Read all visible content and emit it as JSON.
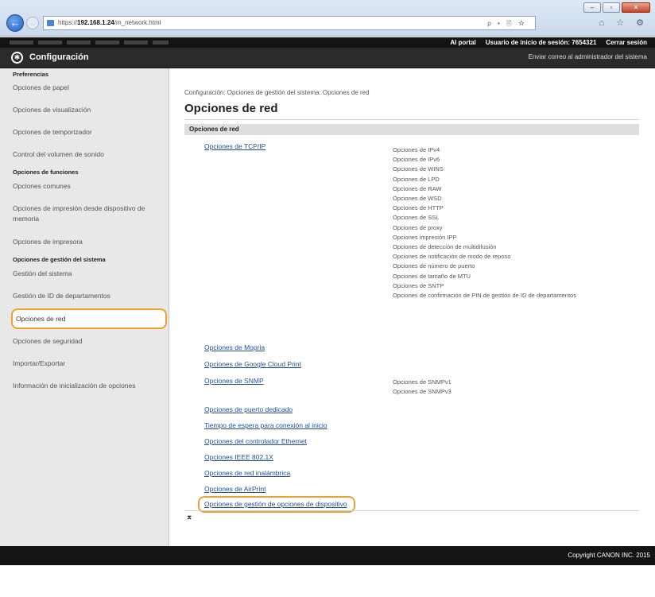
{
  "browser": {
    "url_prefix": "https://",
    "url_host": "192.168.1.24",
    "url_path": "/m_network.html",
    "tools": "ρ • 🖹 ☆",
    "tab_icons": "⌂ ☆ ⚙",
    "window_buttons": [
      "–",
      "▫",
      "✕"
    ]
  },
  "topbar": {
    "portal": "Al portal",
    "user_label": "Usuario de inicio de sesión:",
    "user_id": "7654321",
    "logout": "Cerrar sesión"
  },
  "confbar": {
    "title": "Configuración",
    "mail": "Enviar correo al administrador del sistema"
  },
  "sidebar": {
    "sec_preferences": "Preferencias",
    "sec_functions": "Opciones de funciones",
    "sec_management": "Opciones de gestión del sistema",
    "items": [
      "Opciones de papel",
      "Opciones de visualización",
      "Opciones de temporizador",
      "Control del volumen de sonido",
      "Opciones comunes",
      "Opciones de impresión desde dispositivo de memoria",
      "Opciones de impresora",
      "Gestión del sistema",
      "Gestión de ID de departamentos",
      "Opciones de red",
      "Opciones de seguridad",
      "Importar/Exportar",
      "Información de inicialización de opciones"
    ]
  },
  "main": {
    "breadcrumb": "Configuración: Opciones de gestión del sistema: Opciones de red",
    "title": "Opciones de red",
    "section": "Opciones de red",
    "links": [
      "Opciones de TCP/IP",
      "Opciones de Mopria",
      "Opciones de Google Cloud Print",
      "Opciones de SNMP",
      "Opciones de puerto dedicado",
      "Tiempo de espera para conexión al inicio",
      "Opciones del controlador Ethernet",
      "Opciones IEEE 802.1X",
      "Opciones de red inalámbrica",
      "Opciones de AirPrint",
      "Opciones de gestión de opciones de dispositivo"
    ],
    "tcpip_subs": [
      "Opciones de IPv4",
      "Opciones de IPv6",
      "Opciones de WINS",
      "Opciones de LPD",
      "Opciones de RAW",
      "Opciones de WSD",
      "Opciones de HTTP",
      "Opciones de SSL",
      "Opciones de proxy",
      "Opciones impresión IPP",
      "Opciones de detección de multidifusión",
      "Opciones de notificación de modo de reposo",
      "Opciones de número de puerto",
      "Opciones de tamaño de MTU",
      "Opciones de SNTP",
      "Opciones de confirmación de PIN de gestión de ID de departamentos"
    ],
    "snmp_subs": [
      "Opciones de SNMPv1",
      "Opciones de SNMPv3"
    ],
    "to_top": "⌅"
  },
  "footer": {
    "copyright": "Copyright CANON INC. 2015"
  }
}
